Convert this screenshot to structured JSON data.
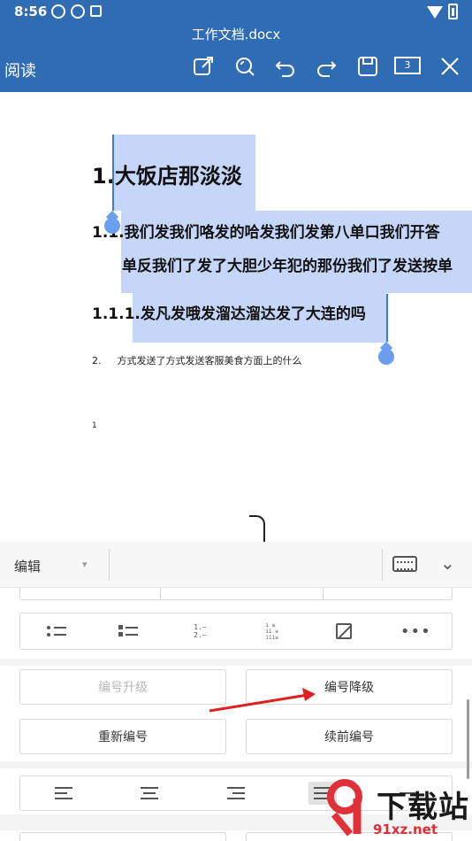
{
  "status_bar": {
    "time": "8:56"
  },
  "title_bar": {
    "document_title": "工作文档.docx",
    "read_mode_label": "阅读",
    "page_count": "3",
    "tools": [
      "edit-icon",
      "search-icon",
      "undo-icon",
      "redo-icon",
      "save-icon",
      "page-count",
      "close-icon"
    ]
  },
  "document": {
    "heading1": "1.大饭店那淡淡",
    "heading2_line1": "1.1.我们发我们咯发的哈发我们发第八单口我们开答",
    "heading2_line2": "单反我们了发了大胆少年犯的那份我们了发送按单",
    "heading3": "1.1.1.发凡发哦发溜达溜达发了大连的吗",
    "list_item_number": "2.",
    "list_item_text": "方式发送了方式发送客服美食方面上的什么",
    "page_marker": "1"
  },
  "panel": {
    "mode_label": "编辑",
    "list_styles": [
      "bullet-list-icon",
      "square-bullet-list-icon",
      "numbered-list-icon",
      "multilevel-list-icon",
      "no-list-icon",
      "more-icon"
    ],
    "buttons": {
      "promote": "编号升级",
      "demote": "编号降级",
      "restart": "重新编号",
      "continue": "续前编号"
    },
    "align_options": [
      "align-left-icon",
      "align-center-icon",
      "align-right-icon",
      "align-justify-icon",
      "distributed-icon"
    ]
  },
  "watermark": {
    "text": "下载站",
    "url": "91xz.net"
  },
  "colors": {
    "title_bar": "#2f6cb3",
    "selection": "#c5d6f8",
    "selection_handle": "#6c9ef0",
    "annotation_arrow": "#e02020"
  }
}
